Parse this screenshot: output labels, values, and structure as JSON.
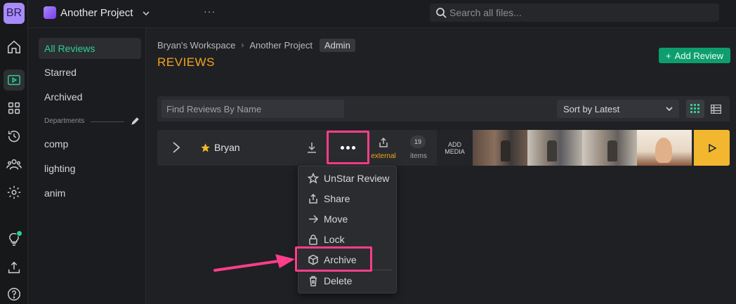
{
  "user": {
    "initials": "BR"
  },
  "topbar": {
    "project_name": "Another Project",
    "more": "···",
    "search_placeholder": "Search all files..."
  },
  "sidebar": {
    "items": [
      {
        "label": "All Reviews",
        "active": true
      },
      {
        "label": "Starred"
      },
      {
        "label": "Archived"
      }
    ],
    "departments_title": "Departments",
    "departments": [
      {
        "label": "comp"
      },
      {
        "label": "lighting"
      },
      {
        "label": "anim"
      }
    ]
  },
  "breadcrumb": {
    "workspace": "Bryan's Workspace",
    "project": "Another Project",
    "role_badge": "Admin"
  },
  "page": {
    "title": "REVIEWS",
    "add_review_label": "Add Review"
  },
  "filters": {
    "find_placeholder": "Find Reviews By Name",
    "sort_label": "Sort by Latest"
  },
  "review_row": {
    "name": "Bryan",
    "starred": true,
    "share_label": "external",
    "item_count": "19",
    "items_label": "items",
    "add_media_label_1": "ADD",
    "add_media_label_2": "MEDIA"
  },
  "menu": {
    "items": [
      {
        "label": "UnStar Review",
        "icon": "star-icon"
      },
      {
        "label": "Share",
        "icon": "share-icon"
      },
      {
        "label": "Move",
        "icon": "arrow-right-icon"
      },
      {
        "label": "Lock",
        "icon": "lock-icon"
      },
      {
        "label": "Archive",
        "icon": "box-icon"
      },
      {
        "label": "Delete",
        "icon": "trash-icon"
      }
    ]
  },
  "colors": {
    "accent_green": "#2fd08f",
    "title_orange": "#f2a51e",
    "highlight_pink": "#ff3d8b",
    "play_yellow": "#f2b72e"
  }
}
